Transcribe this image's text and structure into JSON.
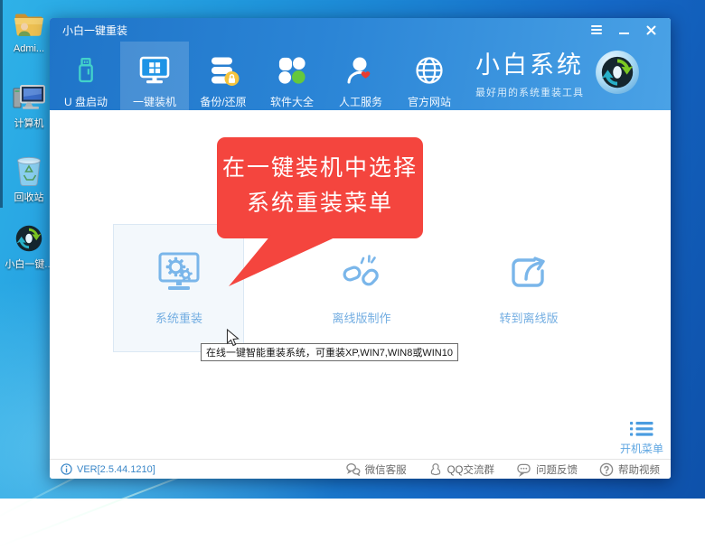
{
  "window": {
    "title": "小白一键重装",
    "controls": [
      {
        "name": "menu-icon"
      },
      {
        "name": "minimize-icon"
      },
      {
        "name": "close-icon"
      }
    ]
  },
  "nav": {
    "items": [
      {
        "label": "U 盘启动",
        "icon": "usb-drive-icon",
        "selected": false
      },
      {
        "label": "一键装机",
        "icon": "monitor-install-icon",
        "selected": true
      },
      {
        "label": "备份/还原",
        "icon": "backup-restore-icon",
        "selected": false
      },
      {
        "label": "软件大全",
        "icon": "software-clover-icon",
        "selected": false
      },
      {
        "label": "人工服务",
        "icon": "support-person-icon",
        "selected": false
      },
      {
        "label": "官方网站",
        "icon": "globe-icon",
        "selected": false
      }
    ]
  },
  "brand": {
    "name": "小白系统",
    "slogan": "最好用的系统重装工具",
    "logo": "sync-arrows-logo"
  },
  "callout": {
    "line1": "在一键装机中选择",
    "line2": "系统重装菜单"
  },
  "actions": [
    {
      "label": "系统重装",
      "icon": "monitor-gears-icon",
      "highlighted": true
    },
    {
      "label": "离线版制作",
      "icon": "broken-chain-icon",
      "highlighted": false
    },
    {
      "label": "转到离线版",
      "icon": "external-arrow-icon",
      "highlighted": false
    }
  ],
  "tooltip": "在线一键智能重装系统，可重装XP,WIN7,WIN8或WIN10",
  "boot_menu": {
    "label": "开机菜单",
    "icon": "list-menu-icon"
  },
  "footer": {
    "version": "VER[2.5.44.1210]",
    "version_icon": "info-icon",
    "links": [
      {
        "label": "微信客服",
        "icon": "wechat-icon"
      },
      {
        "label": "QQ交流群",
        "icon": "qq-icon"
      },
      {
        "label": "问题反馈",
        "icon": "feedback-bubble-icon"
      },
      {
        "label": "帮助视频",
        "icon": "help-question-icon"
      }
    ]
  },
  "desktop": {
    "icons": [
      {
        "label": "Admi...",
        "icon": "user-folder-icon"
      },
      {
        "label": "计算机",
        "icon": "computer-icon"
      },
      {
        "label": "回收站",
        "icon": "recycle-bin-icon"
      },
      {
        "label": "小白一键...",
        "icon": "xiaobai-sync-icon"
      }
    ]
  },
  "colors": {
    "accent_red": "#f4453e",
    "icon_blue": "#7ab6ea",
    "header_blue": "#2b85d6",
    "teal": "#3fd0c8",
    "green": "#64c83c",
    "version_blue": "#3a87c8",
    "footer_link_gray": "#6a6a6a"
  }
}
